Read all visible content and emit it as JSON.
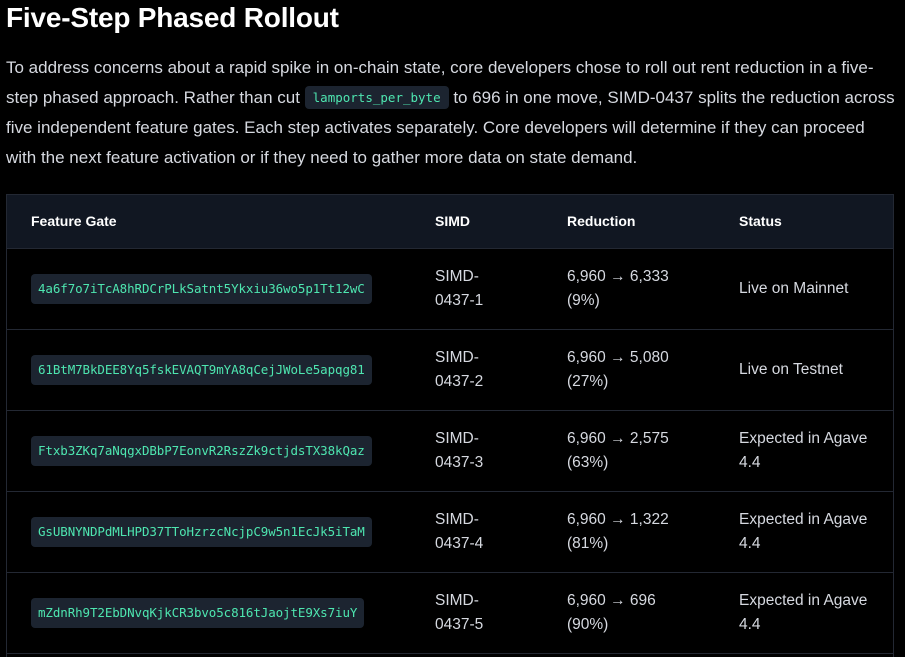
{
  "heading": "Five-Step Phased Rollout",
  "intro": {
    "part1": "To address concerns about a rapid spike in on-chain state, core developers chose to roll out rent reduction in a five-step phased approach. Rather than cut ",
    "code": "lamports_per_byte",
    "part2": " to 696 in one move, SIMD-0437 splits the reduction across five independent feature gates. Each step activates separately. Core developers will determine if they can proceed with the next feature activation or if they need to gather more data on state demand."
  },
  "table": {
    "headers": {
      "feature_gate": "Feature Gate",
      "simd": "SIMD",
      "reduction": "Reduction",
      "status": "Status"
    },
    "rows": [
      {
        "gate": "4a6f7o7iTcA8hRDCrPLkSatnt5Ykxiu36wo5p1Tt12wC",
        "simd_a": "SIMD-",
        "simd_b": "0437-1",
        "reduction_a": "6,960 → 6,333",
        "reduction_b": "(9%)",
        "status_a": "Live on Mainnet",
        "status_b": ""
      },
      {
        "gate": "61BtM7BkDEE8Yq5fskEVAQT9mYA8qCejJWoLe5apqg81",
        "simd_a": "SIMD-",
        "simd_b": "0437-2",
        "reduction_a": "6,960 → 5,080",
        "reduction_b": "(27%)",
        "status_a": "Live on Testnet",
        "status_b": ""
      },
      {
        "gate": "Ftxb3ZKq7aNqgxDBbP7EonvR2RszZk9ctjdsTX38kQaz",
        "simd_a": "SIMD-",
        "simd_b": "0437-3",
        "reduction_a": "6,960 → 2,575",
        "reduction_b": "(63%)",
        "status_a": "Expected in Agave",
        "status_b": "4.4"
      },
      {
        "gate": "GsUBNYNDPdMLHPD37TToHzrzcNcjpC9w5n1EcJk5iTaM",
        "simd_a": "SIMD-",
        "simd_b": "0437-4",
        "reduction_a": "6,960 → 1,322",
        "reduction_b": "(81%)",
        "status_a": "Expected in Agave",
        "status_b": "4.4"
      },
      {
        "gate": "mZdnRh9T2EbDNvqKjkCR3bvo5c816tJaojtE9Xs7iuY",
        "simd_a": "SIMD-",
        "simd_b": "0437-5",
        "reduction_a": "6,960 → 696",
        "reduction_b": "(90%)",
        "status_a": "Expected in Agave",
        "status_b": "4.4"
      }
    ]
  }
}
